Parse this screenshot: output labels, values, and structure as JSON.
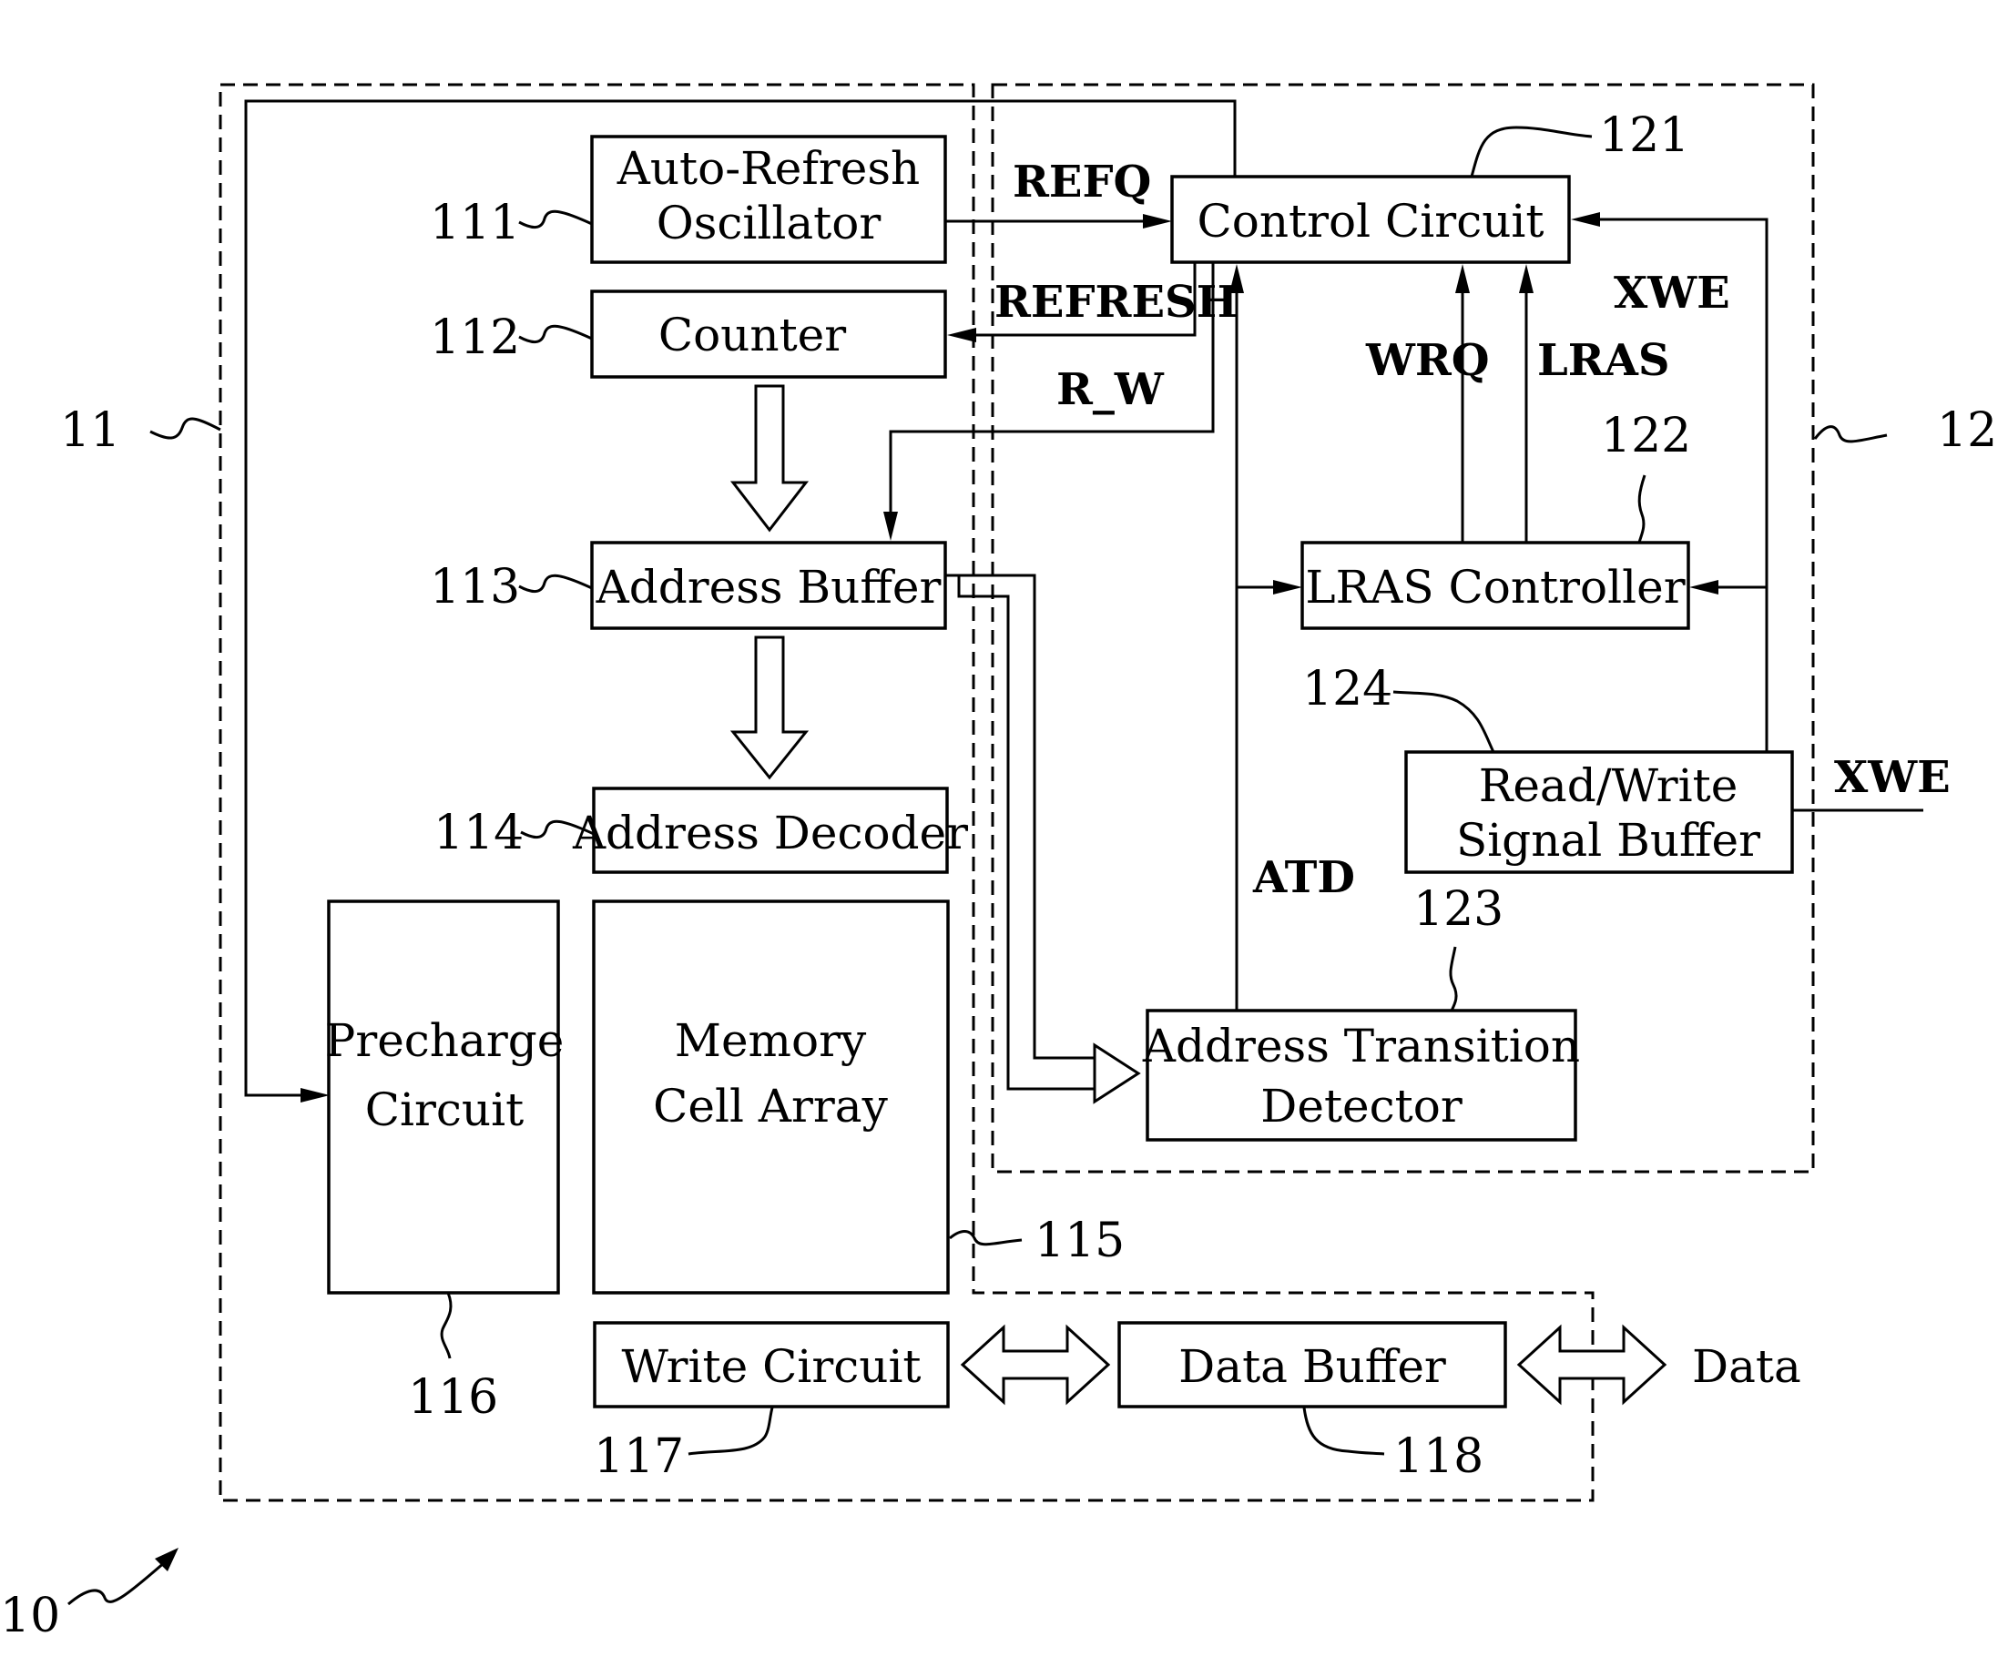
{
  "figure": {
    "ref": "10",
    "sections": [
      {
        "ref": "11"
      },
      {
        "ref": "12"
      }
    ]
  },
  "blocks": {
    "auto_refresh_osc": {
      "ref": "111",
      "line1": "Auto-Refresh",
      "line2": "Oscillator"
    },
    "counter": {
      "ref": "112",
      "label": "Counter"
    },
    "address_buffer": {
      "ref": "113",
      "label": "Address Buffer"
    },
    "address_decoder": {
      "ref": "114",
      "label": "Address Decoder"
    },
    "memory_cell_array": {
      "ref": "115",
      "line1": "Memory",
      "line2": "Cell Array"
    },
    "precharge_circuit": {
      "ref": "116",
      "line1": "Precharge",
      "line2": "Circuit"
    },
    "write_circuit": {
      "ref": "117",
      "label": "Write Circuit"
    },
    "data_buffer": {
      "ref": "118",
      "label": "Data Buffer"
    },
    "control_circuit": {
      "ref": "121",
      "label": "Control Circuit"
    },
    "lras_controller": {
      "ref": "122",
      "label": "LRAS Controller"
    },
    "address_transition_detector": {
      "ref": "123",
      "line1": "Address Transition",
      "line2": "Detector"
    },
    "rw_signal_buffer": {
      "ref": "124",
      "line1": "Read/Write",
      "line2": "Signal Buffer"
    }
  },
  "signals": {
    "refq": "REFQ",
    "refresh": "REFRESH",
    "r_w": "R_W",
    "xwe_internal": "XWE",
    "wrq": "WRQ",
    "lras": "LRAS",
    "atd": "ATD",
    "xwe_input": "XWE",
    "data": "Data"
  }
}
